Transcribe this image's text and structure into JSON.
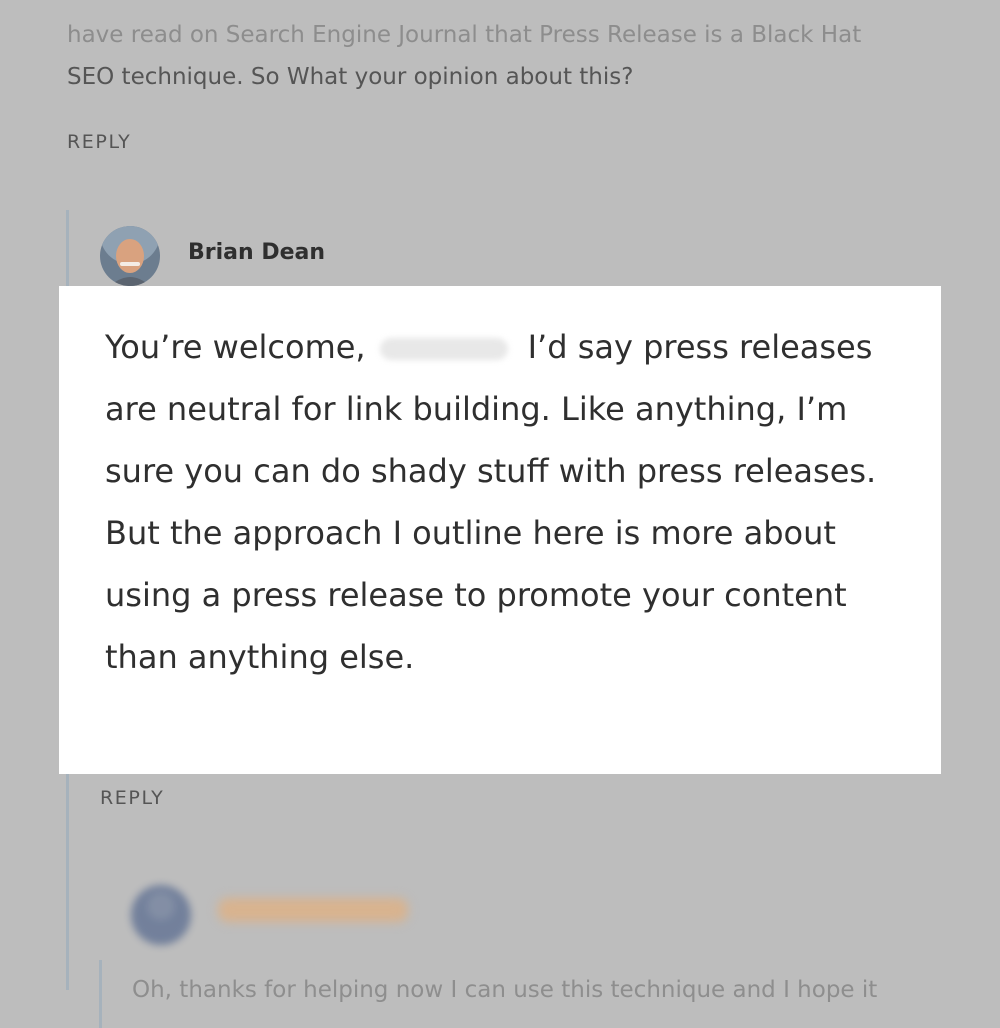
{
  "top_comment": {
    "line1": "have read on Search Engine Journal that Press Release is a Black Hat",
    "line2": "SEO technique. So What your opinion about this?"
  },
  "reply_label_top": "REPLY",
  "reply": {
    "author": "Brian Dean",
    "text_before_name": "You’re welcome,",
    "text_after_name": "I’d say press releases are neutral for link building. Like anything, I’m sure you can do shady stuff with press releases. But the approach I outline here is more about using a press release to promote your content than anything else.",
    "reply_label": "REPLY"
  },
  "nested_comment": {
    "text": "Oh, thanks for helping now I can use this technique and I hope it"
  },
  "colors": {
    "background": "#bdbdbd",
    "callout": "#ffffff",
    "thread_line": "#a6b2bc"
  }
}
